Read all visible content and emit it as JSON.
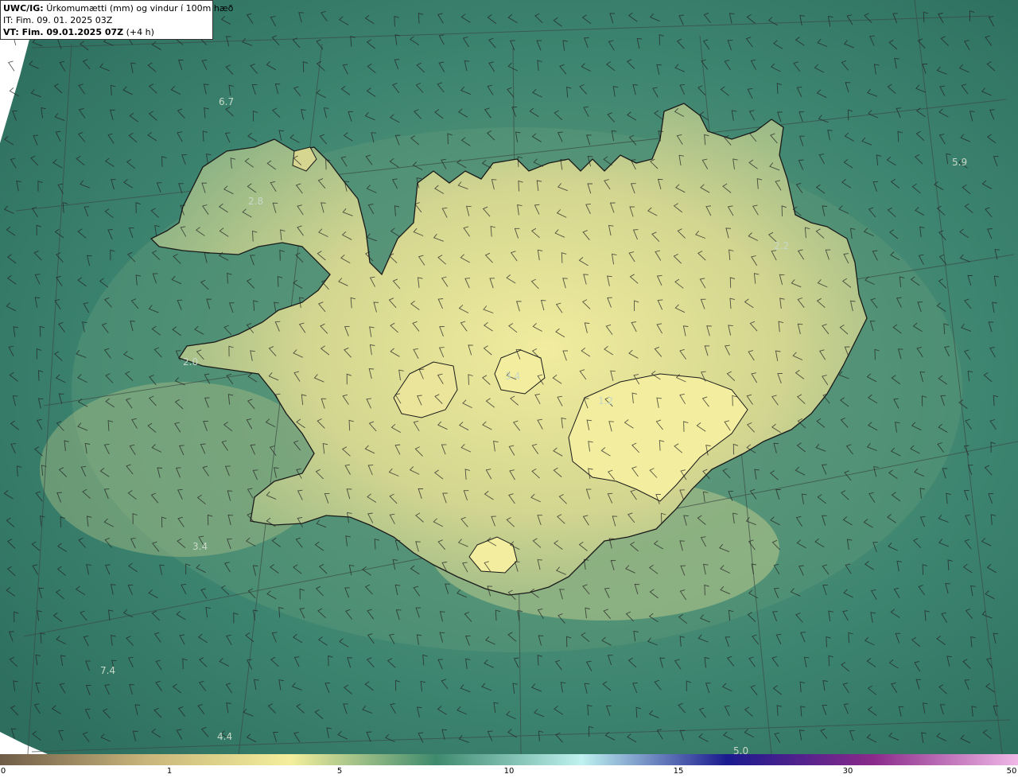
{
  "header": {
    "product": "UWC/IG:",
    "description": "Úrkomumætti (mm) og vindur í 100m hæð",
    "it_line": "IT: Fim. 09. 01. 2025 03Z",
    "vt_label": "VT: Fim. 09.01.2025 07Z",
    "vt_offset": "(+4 h)"
  },
  "map_labels": [
    "6.7",
    "2.8",
    "5.9",
    "2.2",
    "2.0",
    "3.4",
    "1.2",
    "3.4",
    "7.4",
    "4.4",
    "5.0"
  ],
  "colorbar": {
    "ticks": [
      "0",
      "1",
      "5",
      "10",
      "15",
      "30",
      "50"
    ],
    "colors": [
      "#6f5c48",
      "#c8b57a",
      "#f4ef9c",
      "#3e8a6e",
      "#bff2f0",
      "#1a1a8e",
      "#8a2a8a",
      "#f0b8e6"
    ]
  },
  "colors": {
    "sea_dark": "#2f6e5c",
    "sea_mid": "#3f8a74",
    "land_light": "#e9e69a",
    "land_mid": "#bfc98a",
    "coast": "#1a1a1a"
  }
}
